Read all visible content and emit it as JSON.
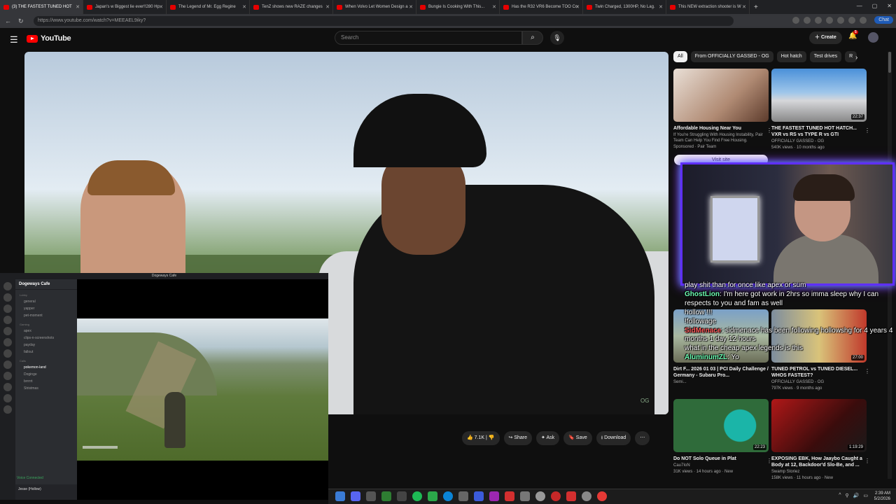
{
  "browser": {
    "tabs": [
      {
        "label": "(3) THE FASTEST TUNED HOT",
        "active": true
      },
      {
        "label": "Japan's w Biggest lie ever!!280 Hp",
        "active": false
      },
      {
        "label": "The Legend of Mr. Egg Regine",
        "active": false
      },
      {
        "label": "TenZ shows new RAZE changes",
        "active": false
      },
      {
        "label": "When Volvo Let Women Design a",
        "active": false
      },
      {
        "label": "Bungie Is Cooking With This...",
        "active": false
      },
      {
        "label": "Has the R32 VR6 Become TOO Co",
        "active": false
      },
      {
        "label": "Twin Charged, 1300HP, No Lag.",
        "active": false
      },
      {
        "label": "This NEW extraction shooter is W",
        "active": false
      }
    ],
    "url": "https://www.youtube.com/watch?v=MEEAEL9iky?",
    "chat_label": "Chat"
  },
  "youtube": {
    "logo": "YouTube",
    "search_placeholder": "Search",
    "create_label": "Create",
    "notif_count": "5",
    "actions": {
      "likes": "7.1K",
      "share": "Share",
      "ask": "Ask",
      "save": "Save",
      "download": "Download"
    },
    "chips": [
      "All",
      "From OFFICIALLY GASSED - OG",
      "Hot hatch",
      "Test drives",
      "R"
    ],
    "visit_site": "Visit site",
    "cards": [
      {
        "title": "Affordable Housing Near You",
        "meta1": "If You're Struggling With Housing Instability, Pair Team Can Help You Find Free Housing.",
        "meta2": "Sponsored · Pair Team",
        "duration": ""
      },
      {
        "title": "THE FASTEST TUNED HOT HATCH... VXR vs RS vs TYPE R vs GTI",
        "meta1": "OFFICIALLY GASSED - OG",
        "meta2": "540K views · 10 months ago",
        "duration": "22:37"
      },
      {
        "title": "Dirt F... 2026 01 03 | PCI Daily Challenge / Germany - Subaru Pro...",
        "meta1": "Semi...",
        "meta2": "",
        "duration": ""
      },
      {
        "title": "TUNED PETROL vs TUNED DIESEL... WHOS FASTEST?",
        "meta1": "OFFICIALLY GASSED - OG",
        "meta2": "797K views · 9 months ago",
        "duration": "27:00"
      },
      {
        "title": "Do NOT Solo Queue in Plat",
        "meta1": "Cau7IoN",
        "meta2": "31K views · 14 hours ago · New",
        "duration": "22:23"
      },
      {
        "title": "EXPOSING EBK, How Jaaybo Caught a Body at 12, Backdoor'd Slo-Be, and ...",
        "meta1": "Swamp Storiez",
        "meta2": "158K views · 11 hours ago · New",
        "duration": "1:19:29"
      }
    ],
    "player_badge": "OG"
  },
  "stream_chat": [
    {
      "user": "",
      "text": "play shit than for once like apex or sum"
    },
    {
      "user": "GhostLion",
      "text": "I'm here got work in 2hrs so imma sleep why I can"
    },
    {
      "user": "",
      "text": "respects to you and fam as well"
    },
    {
      "user": "",
      "text": "hollow !!!"
    },
    {
      "user": "",
      "text": "!followage"
    },
    {
      "user": "SidMenace",
      "text": "sidmenace has been following hollowshg for 4 years 4 months 1 day 12 hours"
    },
    {
      "user": "",
      "text": "what in the cheap apex legends is this"
    },
    {
      "user": "AluminumZL",
      "text": "Yo"
    }
  ],
  "discord": {
    "title": "Dogeways Cafe",
    "server": "Dogeways Cafe",
    "channels": [
      {
        "name": "Lobby",
        "cat": true
      },
      {
        "name": "general",
        "cat": false
      },
      {
        "name": "yapper",
        "cat": false
      },
      {
        "name": "pet-moment",
        "cat": false
      },
      {
        "name": "Gaming",
        "cat": true
      },
      {
        "name": "apex",
        "cat": false
      },
      {
        "name": "clips-n-screenshots",
        "cat": false
      },
      {
        "name": "payday",
        "cat": false
      },
      {
        "name": "fallout",
        "cat": false
      },
      {
        "name": "Calls",
        "cat": true
      },
      {
        "name": "pokemon-land",
        "cat": false
      },
      {
        "name": "Doginge",
        "cat": false
      },
      {
        "name": "brrrrrt",
        "cat": false
      },
      {
        "name": "Stristmas",
        "cat": false
      }
    ],
    "voice": "Voice Connected",
    "user": "Jesse (Hollow)"
  },
  "taskbar": {
    "time": "2:39 AM",
    "date": "5/2/2026"
  }
}
